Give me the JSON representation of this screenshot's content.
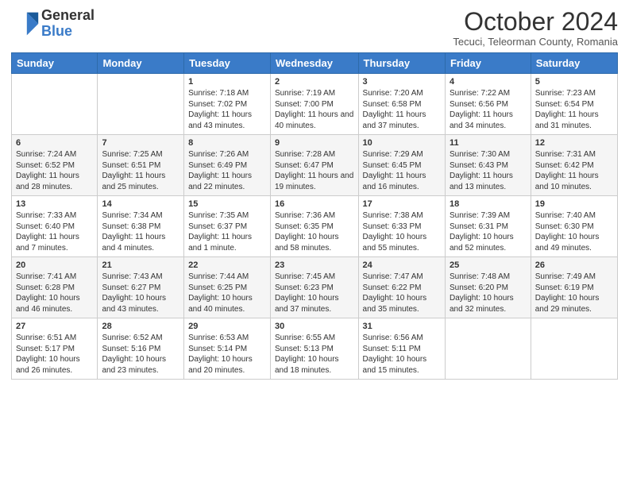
{
  "logo": {
    "general": "General",
    "blue": "Blue"
  },
  "header": {
    "month": "October 2024",
    "location": "Tecuci, Teleorman County, Romania"
  },
  "weekdays": [
    "Sunday",
    "Monday",
    "Tuesday",
    "Wednesday",
    "Thursday",
    "Friday",
    "Saturday"
  ],
  "weeks": [
    [
      {
        "day": "",
        "info": ""
      },
      {
        "day": "",
        "info": ""
      },
      {
        "day": "1",
        "info": "Sunrise: 7:18 AM\nSunset: 7:02 PM\nDaylight: 11 hours and 43 minutes."
      },
      {
        "day": "2",
        "info": "Sunrise: 7:19 AM\nSunset: 7:00 PM\nDaylight: 11 hours and 40 minutes."
      },
      {
        "day": "3",
        "info": "Sunrise: 7:20 AM\nSunset: 6:58 PM\nDaylight: 11 hours and 37 minutes."
      },
      {
        "day": "4",
        "info": "Sunrise: 7:22 AM\nSunset: 6:56 PM\nDaylight: 11 hours and 34 minutes."
      },
      {
        "day": "5",
        "info": "Sunrise: 7:23 AM\nSunset: 6:54 PM\nDaylight: 11 hours and 31 minutes."
      }
    ],
    [
      {
        "day": "6",
        "info": "Sunrise: 7:24 AM\nSunset: 6:52 PM\nDaylight: 11 hours and 28 minutes."
      },
      {
        "day": "7",
        "info": "Sunrise: 7:25 AM\nSunset: 6:51 PM\nDaylight: 11 hours and 25 minutes."
      },
      {
        "day": "8",
        "info": "Sunrise: 7:26 AM\nSunset: 6:49 PM\nDaylight: 11 hours and 22 minutes."
      },
      {
        "day": "9",
        "info": "Sunrise: 7:28 AM\nSunset: 6:47 PM\nDaylight: 11 hours and 19 minutes."
      },
      {
        "day": "10",
        "info": "Sunrise: 7:29 AM\nSunset: 6:45 PM\nDaylight: 11 hours and 16 minutes."
      },
      {
        "day": "11",
        "info": "Sunrise: 7:30 AM\nSunset: 6:43 PM\nDaylight: 11 hours and 13 minutes."
      },
      {
        "day": "12",
        "info": "Sunrise: 7:31 AM\nSunset: 6:42 PM\nDaylight: 11 hours and 10 minutes."
      }
    ],
    [
      {
        "day": "13",
        "info": "Sunrise: 7:33 AM\nSunset: 6:40 PM\nDaylight: 11 hours and 7 minutes."
      },
      {
        "day": "14",
        "info": "Sunrise: 7:34 AM\nSunset: 6:38 PM\nDaylight: 11 hours and 4 minutes."
      },
      {
        "day": "15",
        "info": "Sunrise: 7:35 AM\nSunset: 6:37 PM\nDaylight: 11 hours and 1 minute."
      },
      {
        "day": "16",
        "info": "Sunrise: 7:36 AM\nSunset: 6:35 PM\nDaylight: 10 hours and 58 minutes."
      },
      {
        "day": "17",
        "info": "Sunrise: 7:38 AM\nSunset: 6:33 PM\nDaylight: 10 hours and 55 minutes."
      },
      {
        "day": "18",
        "info": "Sunrise: 7:39 AM\nSunset: 6:31 PM\nDaylight: 10 hours and 52 minutes."
      },
      {
        "day": "19",
        "info": "Sunrise: 7:40 AM\nSunset: 6:30 PM\nDaylight: 10 hours and 49 minutes."
      }
    ],
    [
      {
        "day": "20",
        "info": "Sunrise: 7:41 AM\nSunset: 6:28 PM\nDaylight: 10 hours and 46 minutes."
      },
      {
        "day": "21",
        "info": "Sunrise: 7:43 AM\nSunset: 6:27 PM\nDaylight: 10 hours and 43 minutes."
      },
      {
        "day": "22",
        "info": "Sunrise: 7:44 AM\nSunset: 6:25 PM\nDaylight: 10 hours and 40 minutes."
      },
      {
        "day": "23",
        "info": "Sunrise: 7:45 AM\nSunset: 6:23 PM\nDaylight: 10 hours and 37 minutes."
      },
      {
        "day": "24",
        "info": "Sunrise: 7:47 AM\nSunset: 6:22 PM\nDaylight: 10 hours and 35 minutes."
      },
      {
        "day": "25",
        "info": "Sunrise: 7:48 AM\nSunset: 6:20 PM\nDaylight: 10 hours and 32 minutes."
      },
      {
        "day": "26",
        "info": "Sunrise: 7:49 AM\nSunset: 6:19 PM\nDaylight: 10 hours and 29 minutes."
      }
    ],
    [
      {
        "day": "27",
        "info": "Sunrise: 6:51 AM\nSunset: 5:17 PM\nDaylight: 10 hours and 26 minutes."
      },
      {
        "day": "28",
        "info": "Sunrise: 6:52 AM\nSunset: 5:16 PM\nDaylight: 10 hours and 23 minutes."
      },
      {
        "day": "29",
        "info": "Sunrise: 6:53 AM\nSunset: 5:14 PM\nDaylight: 10 hours and 20 minutes."
      },
      {
        "day": "30",
        "info": "Sunrise: 6:55 AM\nSunset: 5:13 PM\nDaylight: 10 hours and 18 minutes."
      },
      {
        "day": "31",
        "info": "Sunrise: 6:56 AM\nSunset: 5:11 PM\nDaylight: 10 hours and 15 minutes."
      },
      {
        "day": "",
        "info": ""
      },
      {
        "day": "",
        "info": ""
      }
    ]
  ]
}
